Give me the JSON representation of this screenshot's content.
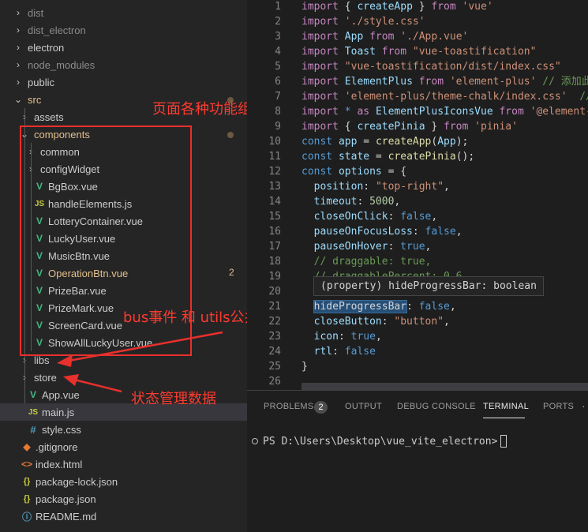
{
  "explorer": {
    "items": [
      {
        "label": "dist",
        "type": "folder",
        "state": "collapsed",
        "dim": true
      },
      {
        "label": "dist_electron",
        "type": "folder",
        "state": "collapsed",
        "dim": true
      },
      {
        "label": "electron",
        "type": "folder",
        "state": "collapsed"
      },
      {
        "label": "node_modules",
        "type": "folder",
        "state": "collapsed",
        "dim": true
      },
      {
        "label": "public",
        "type": "folder",
        "state": "collapsed"
      },
      {
        "label": "src",
        "type": "folder",
        "state": "expanded",
        "color": "orange"
      },
      {
        "label": "assets",
        "type": "folder",
        "state": "collapsed"
      },
      {
        "label": "components",
        "type": "folder",
        "state": "expanded",
        "color": "orange"
      },
      {
        "label": "common",
        "type": "folder",
        "state": "collapsed"
      },
      {
        "label": "configWidget",
        "type": "folder",
        "state": "collapsed"
      },
      {
        "label": "BgBox.vue",
        "type": "vue"
      },
      {
        "label": "handleElements.js",
        "type": "js"
      },
      {
        "label": "LotteryContainer.vue",
        "type": "vue"
      },
      {
        "label": "LuckyUser.vue",
        "type": "vue"
      },
      {
        "label": "MusicBtn.vue",
        "type": "vue"
      },
      {
        "label": "OperationBtn.vue",
        "type": "vue",
        "color": "orange",
        "badge": "2"
      },
      {
        "label": "PrizeBar.vue",
        "type": "vue"
      },
      {
        "label": "PrizeMark.vue",
        "type": "vue"
      },
      {
        "label": "ScreenCard.vue",
        "type": "vue"
      },
      {
        "label": "ShowAllLuckyUser.vue",
        "type": "vue"
      },
      {
        "label": "libs",
        "type": "folder",
        "state": "collapsed"
      },
      {
        "label": "store",
        "type": "folder",
        "state": "collapsed"
      },
      {
        "label": "App.vue",
        "type": "vue"
      },
      {
        "label": "main.js",
        "type": "js",
        "selected": true
      },
      {
        "label": "style.css",
        "type": "css"
      },
      {
        "label": ".gitignore",
        "type": "git"
      },
      {
        "label": "index.html",
        "type": "html"
      },
      {
        "label": "package-lock.json",
        "type": "json"
      },
      {
        "label": "package.json",
        "type": "json"
      },
      {
        "label": "README.md",
        "type": "info"
      }
    ]
  },
  "annotations": {
    "components_note": "页面各种功能组件",
    "libs_note": "bus事件 和 utils公共方法",
    "store_note": "状态管理数据"
  },
  "editor": {
    "lines": [
      {
        "n": "1",
        "tokens": [
          [
            "kw",
            "import"
          ],
          [
            "d",
            " { "
          ],
          [
            "id",
            "createApp"
          ],
          [
            "d",
            " } "
          ],
          [
            "kw",
            "from"
          ],
          [
            "d",
            " "
          ],
          [
            "str",
            "'vue'"
          ]
        ]
      },
      {
        "n": "2",
        "tokens": [
          [
            "kw",
            "import"
          ],
          [
            "d",
            " "
          ],
          [
            "str",
            "'./style.css'"
          ]
        ]
      },
      {
        "n": "3",
        "tokens": [
          [
            "kw",
            "import"
          ],
          [
            "d",
            " "
          ],
          [
            "id",
            "App"
          ],
          [
            "d",
            " "
          ],
          [
            "kw",
            "from"
          ],
          [
            "d",
            " "
          ],
          [
            "str",
            "'./App.vue'"
          ]
        ]
      },
      {
        "n": "4",
        "tokens": [
          [
            "kw",
            "import"
          ],
          [
            "d",
            " "
          ],
          [
            "id",
            "Toast"
          ],
          [
            "d",
            " "
          ],
          [
            "kw",
            "from"
          ],
          [
            "d",
            " "
          ],
          [
            "str",
            "\"vue-toastification\""
          ]
        ]
      },
      {
        "n": "5",
        "tokens": [
          [
            "kw",
            "import"
          ],
          [
            "d",
            " "
          ],
          [
            "str",
            "\"vue-toastification/dist/index.css\""
          ]
        ]
      },
      {
        "n": "6",
        "tokens": [
          [
            "kw",
            "import"
          ],
          [
            "d",
            " "
          ],
          [
            "id",
            "ElementPlus"
          ],
          [
            "d",
            " "
          ],
          [
            "kw",
            "from"
          ],
          [
            "d",
            " "
          ],
          [
            "str",
            "'element-plus'"
          ],
          [
            "d",
            " "
          ],
          [
            "cm",
            "// 添加此"
          ]
        ]
      },
      {
        "n": "7",
        "tokens": [
          [
            "kw",
            "import"
          ],
          [
            "d",
            " "
          ],
          [
            "str",
            "'element-plus/theme-chalk/index.css'"
          ],
          [
            "d",
            "  "
          ],
          [
            "cm",
            "//"
          ]
        ]
      },
      {
        "n": "8",
        "tokens": [
          [
            "kw",
            "import"
          ],
          [
            "d",
            " "
          ],
          [
            "kb",
            "*"
          ],
          [
            "d",
            " "
          ],
          [
            "kw",
            "as"
          ],
          [
            "d",
            " "
          ],
          [
            "id",
            "ElementPlusIconsVue"
          ],
          [
            "d",
            " "
          ],
          [
            "kw",
            "from"
          ],
          [
            "d",
            " "
          ],
          [
            "str",
            "'@element-"
          ]
        ]
      },
      {
        "n": "9",
        "tokens": [
          [
            "kw",
            "import"
          ],
          [
            "d",
            " { "
          ],
          [
            "id",
            "createPinia"
          ],
          [
            "d",
            " } "
          ],
          [
            "kw",
            "from"
          ],
          [
            "d",
            " "
          ],
          [
            "str",
            "'pinia'"
          ]
        ]
      },
      {
        "n": "10",
        "tokens": [
          [
            "kb",
            "const"
          ],
          [
            "d",
            " "
          ],
          [
            "id",
            "app"
          ],
          [
            "d",
            " = "
          ],
          [
            "fn",
            "createApp"
          ],
          [
            "d",
            "("
          ],
          [
            "id",
            "App"
          ],
          [
            "d",
            ");"
          ]
        ]
      },
      {
        "n": "11",
        "tokens": [
          [
            "kb",
            "const"
          ],
          [
            "d",
            " "
          ],
          [
            "id",
            "state"
          ],
          [
            "d",
            " = "
          ],
          [
            "fn",
            "createPinia"
          ],
          [
            "d",
            "();"
          ]
        ]
      },
      {
        "n": "12",
        "tokens": [
          [
            "kb",
            "const"
          ],
          [
            "d",
            " "
          ],
          [
            "id",
            "options"
          ],
          [
            "d",
            " = {"
          ]
        ]
      },
      {
        "n": "13",
        "tokens": [
          [
            "d",
            "  "
          ],
          [
            "id",
            "position"
          ],
          [
            "d",
            ": "
          ],
          [
            "str",
            "\"top-right\""
          ],
          [
            "d",
            ","
          ]
        ]
      },
      {
        "n": "14",
        "tokens": [
          [
            "d",
            "  "
          ],
          [
            "id",
            "timeout"
          ],
          [
            "d",
            ": "
          ],
          [
            "num",
            "5000"
          ],
          [
            "d",
            ","
          ]
        ]
      },
      {
        "n": "15",
        "tokens": [
          [
            "d",
            "  "
          ],
          [
            "id",
            "closeOnClick"
          ],
          [
            "d",
            ": "
          ],
          [
            "kb",
            "false"
          ],
          [
            "d",
            ","
          ]
        ]
      },
      {
        "n": "16",
        "tokens": [
          [
            "d",
            "  "
          ],
          [
            "id",
            "pauseOnFocusLoss"
          ],
          [
            "d",
            ": "
          ],
          [
            "kb",
            "false"
          ],
          [
            "d",
            ","
          ]
        ]
      },
      {
        "n": "17",
        "tokens": [
          [
            "d",
            "  "
          ],
          [
            "id",
            "pauseOnHover"
          ],
          [
            "d",
            ": "
          ],
          [
            "kb",
            "true"
          ],
          [
            "d",
            ","
          ]
        ]
      },
      {
        "n": "18",
        "tokens": [
          [
            "d",
            "  "
          ],
          [
            "cm",
            "// draggable: true,"
          ]
        ]
      },
      {
        "n": "19",
        "tokens": [
          [
            "d",
            "  "
          ],
          [
            "cm",
            "// draggablePercent: 0.6,"
          ]
        ]
      },
      {
        "n": "20",
        "tokens": []
      },
      {
        "n": "21",
        "tokens": [
          [
            "d",
            "  "
          ],
          [
            "hl",
            "hideProgressBar"
          ],
          [
            "d",
            ": "
          ],
          [
            "kb",
            "false"
          ],
          [
            "d",
            ","
          ]
        ]
      },
      {
        "n": "22",
        "tokens": [
          [
            "d",
            "  "
          ],
          [
            "id",
            "closeButton"
          ],
          [
            "d",
            ": "
          ],
          [
            "str",
            "\"button\""
          ],
          [
            "d",
            ","
          ]
        ]
      },
      {
        "n": "23",
        "tokens": [
          [
            "d",
            "  "
          ],
          [
            "id",
            "icon"
          ],
          [
            "d",
            ": "
          ],
          [
            "kb",
            "true"
          ],
          [
            "d",
            ","
          ]
        ]
      },
      {
        "n": "24",
        "tokens": [
          [
            "d",
            "  "
          ],
          [
            "id",
            "rtl"
          ],
          [
            "d",
            ": "
          ],
          [
            "kb",
            "false"
          ]
        ]
      },
      {
        "n": "25",
        "tokens": [
          [
            "d",
            "}"
          ]
        ]
      },
      {
        "n": "26",
        "tokens": []
      }
    ],
    "tooltip": "(property) hideProgressBar: boolean"
  },
  "panel": {
    "tabs": [
      "PROBLEMS",
      "OUTPUT",
      "DEBUG CONSOLE",
      "TERMINAL",
      "PORTS"
    ],
    "active_tab": "TERMINAL",
    "problems_count": "2",
    "more": "·",
    "terminal_prompt": "PS D:\\Users\\Desktop\\vue_vite_electron>"
  },
  "colors": {
    "annotation": "#e8302c",
    "modified": "#e2c08d"
  }
}
